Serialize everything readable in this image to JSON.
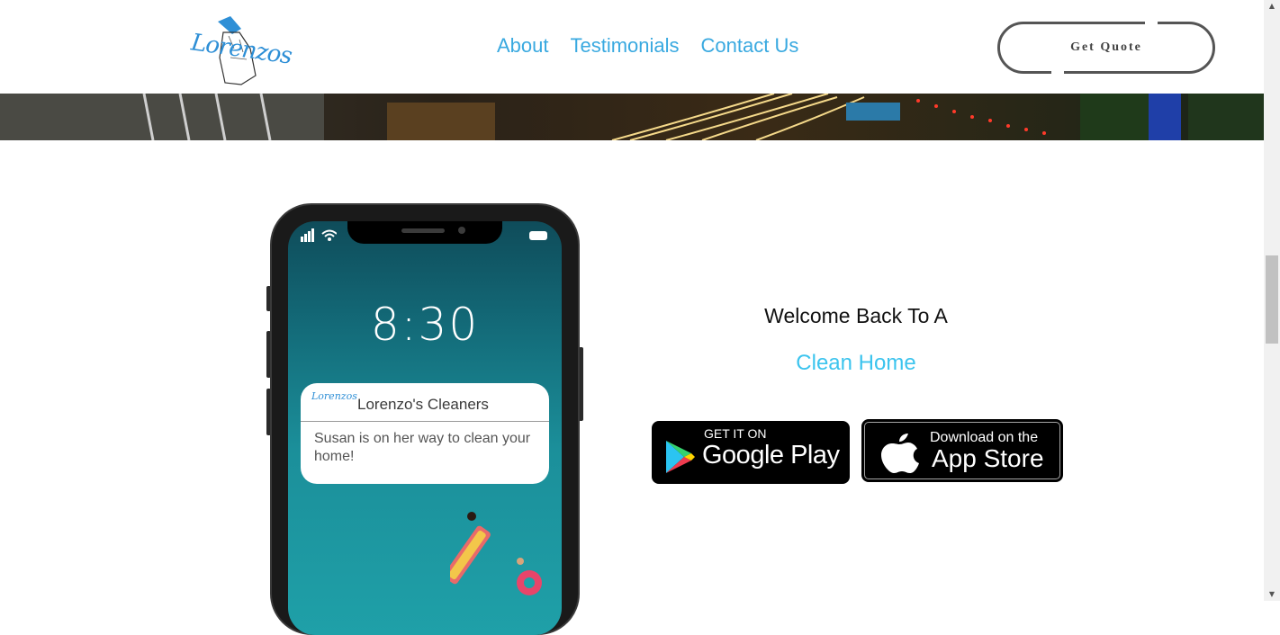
{
  "header": {
    "logo_text": "Lorenzos",
    "nav": [
      "About",
      "Testimonials",
      "Contact Us"
    ],
    "cta_label": "Get Quote"
  },
  "phone": {
    "time": "8:30",
    "notification": {
      "logo_text": "Lorenzos",
      "title": "Lorenzo's Cleaners",
      "body": "Susan is on her way to clean your home!"
    }
  },
  "hero": {
    "welcome": "Welcome Back To A",
    "highlight": "Clean Home"
  },
  "stores": {
    "google_small": "GET IT ON",
    "google_big": "Google Play",
    "apple_small": "Download on the",
    "apple_big": "App Store"
  },
  "colors": {
    "nav": "#39a9e0",
    "highlight": "#3cc4ee",
    "brand": "#2e8fd6"
  },
  "icons": [
    "spray-bottle-icon",
    "signal-icon",
    "wifi-icon",
    "battery-icon",
    "google-play-icon",
    "apple-icon"
  ]
}
